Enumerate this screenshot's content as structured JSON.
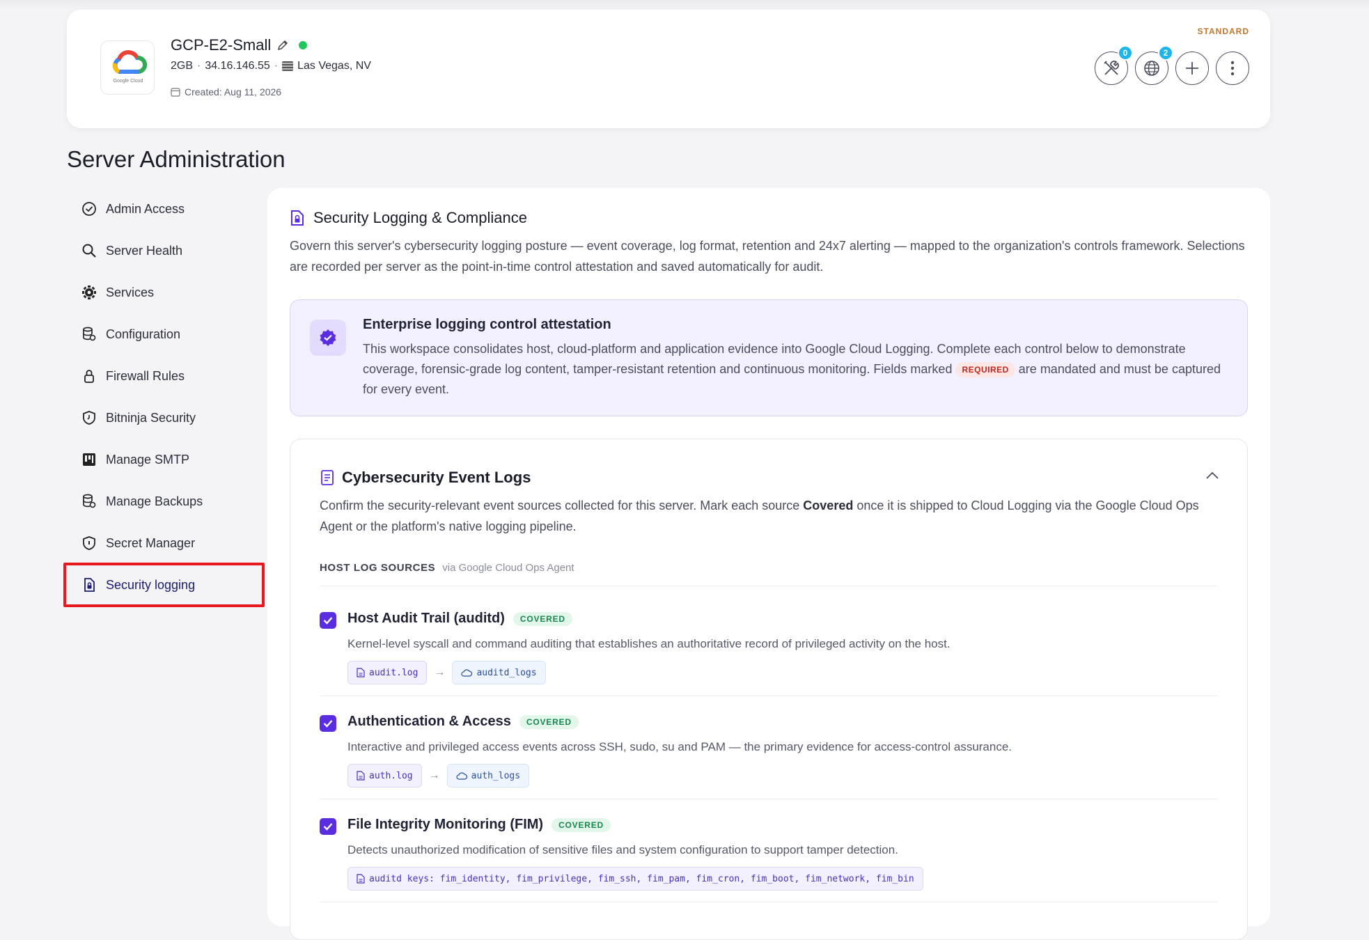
{
  "server": {
    "name": "GCP-E2-Small",
    "ram": "2GB",
    "ip": "34.16.146.55",
    "location": "Las Vegas, NV",
    "created": "Created: Aug 11, 2026",
    "plan": "STANDARD",
    "logo_caption": "Google Cloud",
    "status_color": "#22c55e",
    "tools_badge": "0",
    "network_badge": "2"
  },
  "page": {
    "title": "Server Administration"
  },
  "sidebar": {
    "items": [
      {
        "label": "Admin Access",
        "icon": "check-circle-icon"
      },
      {
        "label": "Server Health",
        "icon": "search-icon"
      },
      {
        "label": "Services",
        "icon": "gear-icon"
      },
      {
        "label": "Configuration",
        "icon": "database-icon"
      },
      {
        "label": "Firewall Rules",
        "icon": "lock-icon"
      },
      {
        "label": "Bitninja Security",
        "icon": "shield-icon"
      },
      {
        "label": "Manage SMTP",
        "icon": "smtp-icon"
      },
      {
        "label": "Manage Backups",
        "icon": "database-icon"
      },
      {
        "label": "Secret Manager",
        "icon": "shield-icon"
      },
      {
        "label": "Security logging",
        "icon": "file-lock-icon"
      }
    ],
    "active": "Security logging"
  },
  "main": {
    "title": "Security Logging & Compliance",
    "description": "Govern this server's cybersecurity logging posture — event coverage, log format, retention and 24x7 alerting — mapped to the organization's controls framework. Selections are recorded per server as the point-in-time control attestation and saved automatically for audit.",
    "attestation": {
      "title": "Enterprise logging control attestation",
      "text_before": "This workspace consolidates host, cloud-platform and application evidence into Google Cloud Logging. Complete each control below to demonstrate coverage, forensic-grade log content, tamper-resistant retention and continuous monitoring. Fields marked ",
      "required_label": "REQUIRED",
      "text_after": " are mandated and must be captured for every event."
    },
    "events": {
      "title": "Cybersecurity Event Logs",
      "desc_before": "Confirm the security-relevant event sources collected for this server. Mark each source ",
      "desc_bold": "Covered",
      "desc_after": " once it is shipped to Cloud Logging via the Google Cloud Ops Agent or the platform's native logging pipeline.",
      "source_label": "HOST LOG SOURCES",
      "source_sub": "via Google Cloud Ops Agent",
      "rows": [
        {
          "title": "Host Audit Trail (auditd)",
          "status": "COVERED",
          "checked": true,
          "description": "Kernel-level syscall and command auditing that establishes an authoritative record of privileged activity on the host.",
          "file": "audit.log",
          "arrow": "→",
          "target": "auditd_logs"
        },
        {
          "title": "Authentication & Access",
          "status": "COVERED",
          "checked": true,
          "description": "Interactive and privileged access events across SSH, sudo, su and PAM — the primary evidence for access-control assurance.",
          "file": "auth.log",
          "arrow": "→",
          "target": "auth_logs"
        },
        {
          "title": "File Integrity Monitoring (FIM)",
          "status": "COVERED",
          "checked": true,
          "description": "Detects unauthorized modification of sensitive files and system configuration to support tamper detection.",
          "file": "auditd keys: fim_identity, fim_privilege, fim_ssh, fim_pam, fim_cron, fim_boot, fim_network, fim_bin"
        }
      ]
    }
  }
}
